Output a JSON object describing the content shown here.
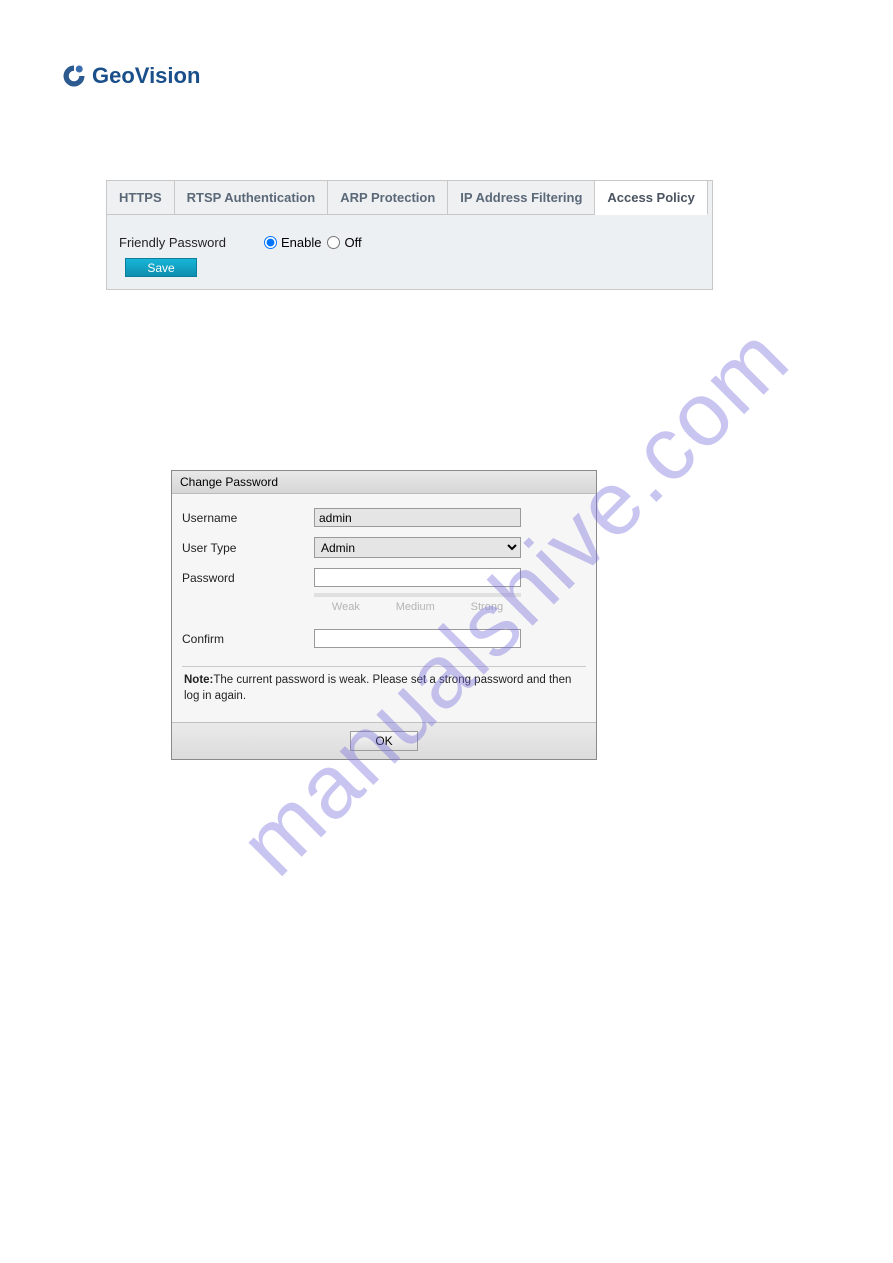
{
  "logo": {
    "text": "GeoVision"
  },
  "watermark": "manualshive.com",
  "tabs": {
    "https": "HTTPS",
    "rtsp": "RTSP Authentication",
    "arp": "ARP Protection",
    "ipfilter": "IP Address Filtering",
    "access": "Access Policy"
  },
  "form": {
    "friendly_password_label": "Friendly Password",
    "enable_label": "Enable",
    "off_label": "Off",
    "save_label": "Save"
  },
  "dialog": {
    "title": "Change Password",
    "username_label": "Username",
    "username_value": "admin",
    "usertype_label": "User Type",
    "usertype_value": "Admin",
    "password_label": "Password",
    "confirm_label": "Confirm",
    "strength": {
      "weak": "Weak",
      "medium": "Medium",
      "strong": "Strong"
    },
    "note_bold": "Note:",
    "note_text": "The current password is weak. Please set a strong password and then log in again.",
    "ok_label": "OK"
  }
}
